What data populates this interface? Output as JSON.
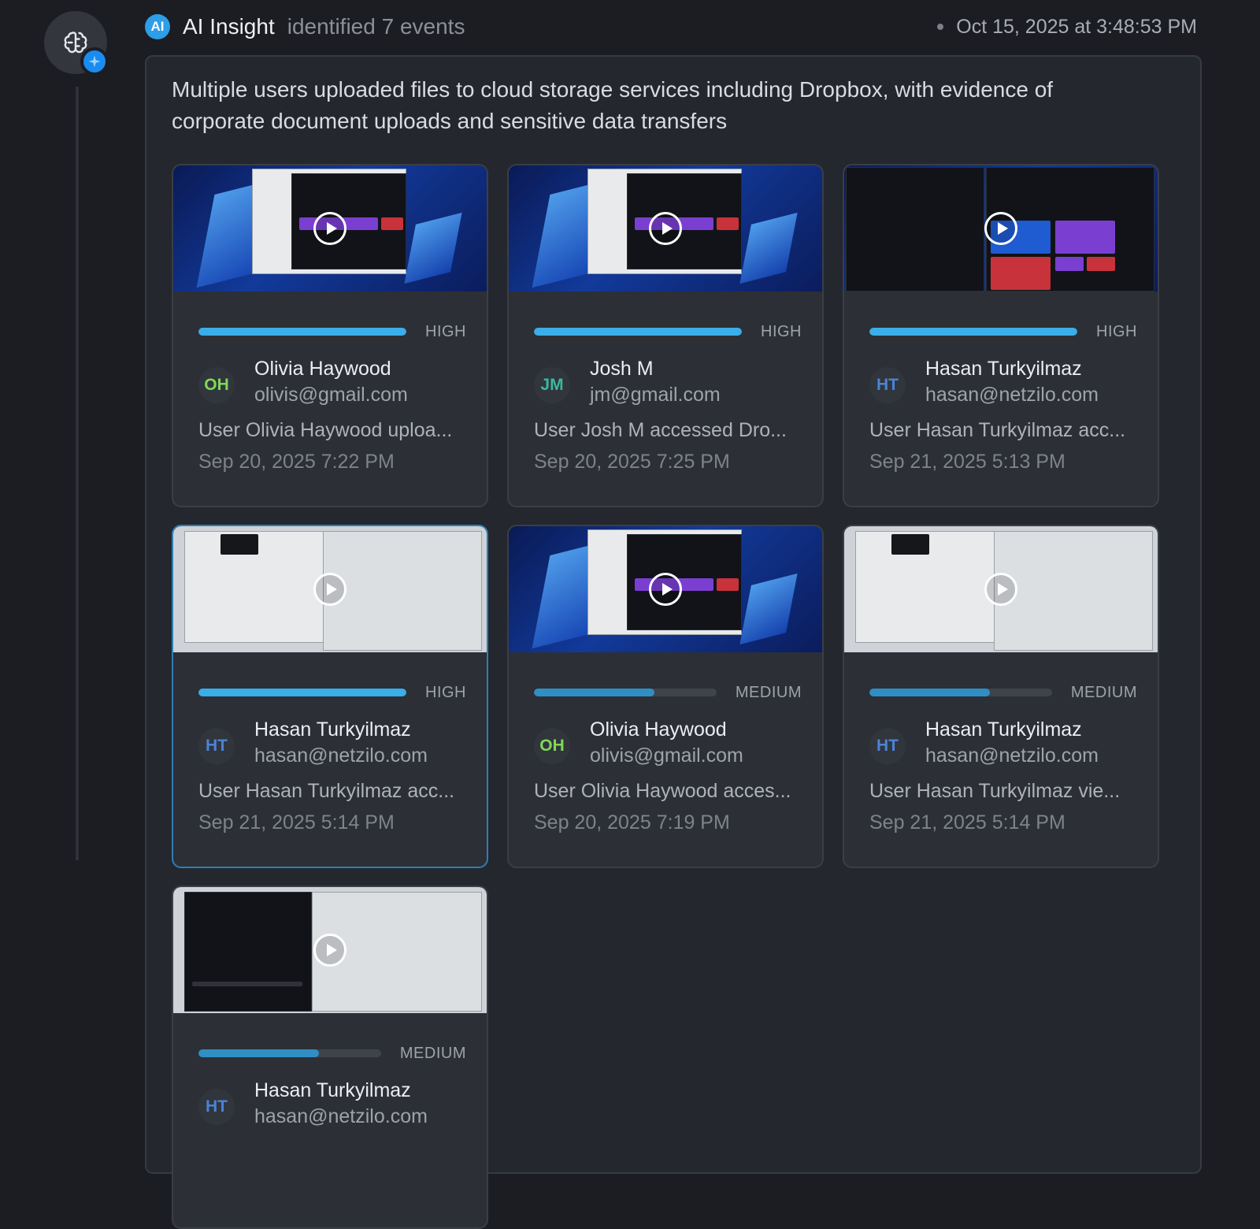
{
  "header": {
    "badge": "AI",
    "title": "AI Insight",
    "subtitle": "identified 7 events",
    "timestamp": "Oct 15, 2025 at 3:48:53 PM"
  },
  "summary": "Multiple users uploaded files to cloud storage services including Dropbox, with evidence of corporate document uploads and sensitive data transfers",
  "colors": {
    "accent": "#2d9ee8",
    "high": "#3aaee8",
    "medium": "#2f8fc4",
    "selected_border": "#2e7fb5"
  },
  "icons": {
    "rail": "brain-icon",
    "badge": "sparkle-icon",
    "thumb_action": "play-icon"
  },
  "events": [
    {
      "severity": "HIGH",
      "level": 1.0,
      "initials": "OH",
      "initials_color": "#7ed957",
      "name": "Olivia Haywood",
      "email": "olivis@gmail.com",
      "desc": "User Olivia Haywood uploa...",
      "date": "Sep 20, 2025 7:22 PM",
      "theme": "blue"
    },
    {
      "severity": "HIGH",
      "level": 1.0,
      "initials": "JM",
      "initials_color": "#3bb8a0",
      "name": "Josh M",
      "email": "jm@gmail.com",
      "desc": "User Josh M accessed Dro...",
      "date": "Sep 20, 2025 7:25 PM",
      "theme": "blue"
    },
    {
      "severity": "HIGH",
      "level": 1.0,
      "initials": "HT",
      "initials_color": "#4a84d6",
      "name": "Hasan Turkyilmaz",
      "email": "hasan@netzilo.com",
      "desc": "User Hasan Turkyilmaz acc...",
      "date": "Sep 21, 2025 5:13 PM",
      "theme": "dark"
    },
    {
      "severity": "HIGH",
      "level": 1.0,
      "initials": "HT",
      "initials_color": "#4a84d6",
      "name": "Hasan Turkyilmaz",
      "email": "hasan@netzilo.com",
      "desc": "User Hasan Turkyilmaz acc...",
      "date": "Sep 21, 2025 5:14 PM",
      "theme": "gray",
      "selected": true
    },
    {
      "severity": "MEDIUM",
      "level": 0.66,
      "initials": "OH",
      "initials_color": "#7ed957",
      "name": "Olivia Haywood",
      "email": "olivis@gmail.com",
      "desc": "User Olivia Haywood acces...",
      "date": "Sep 20, 2025 7:19 PM",
      "theme": "blue"
    },
    {
      "severity": "MEDIUM",
      "level": 0.66,
      "initials": "HT",
      "initials_color": "#4a84d6",
      "name": "Hasan Turkyilmaz",
      "email": "hasan@netzilo.com",
      "desc": "User Hasan Turkyilmaz vie...",
      "date": "Sep 21, 2025 5:14 PM",
      "theme": "gray"
    },
    {
      "severity": "MEDIUM",
      "level": 0.66,
      "initials": "HT",
      "initials_color": "#4a84d6",
      "name": "Hasan Turkyilmaz",
      "email": "hasan@netzilo.com",
      "desc": "",
      "date": "",
      "theme": "graydark"
    }
  ]
}
